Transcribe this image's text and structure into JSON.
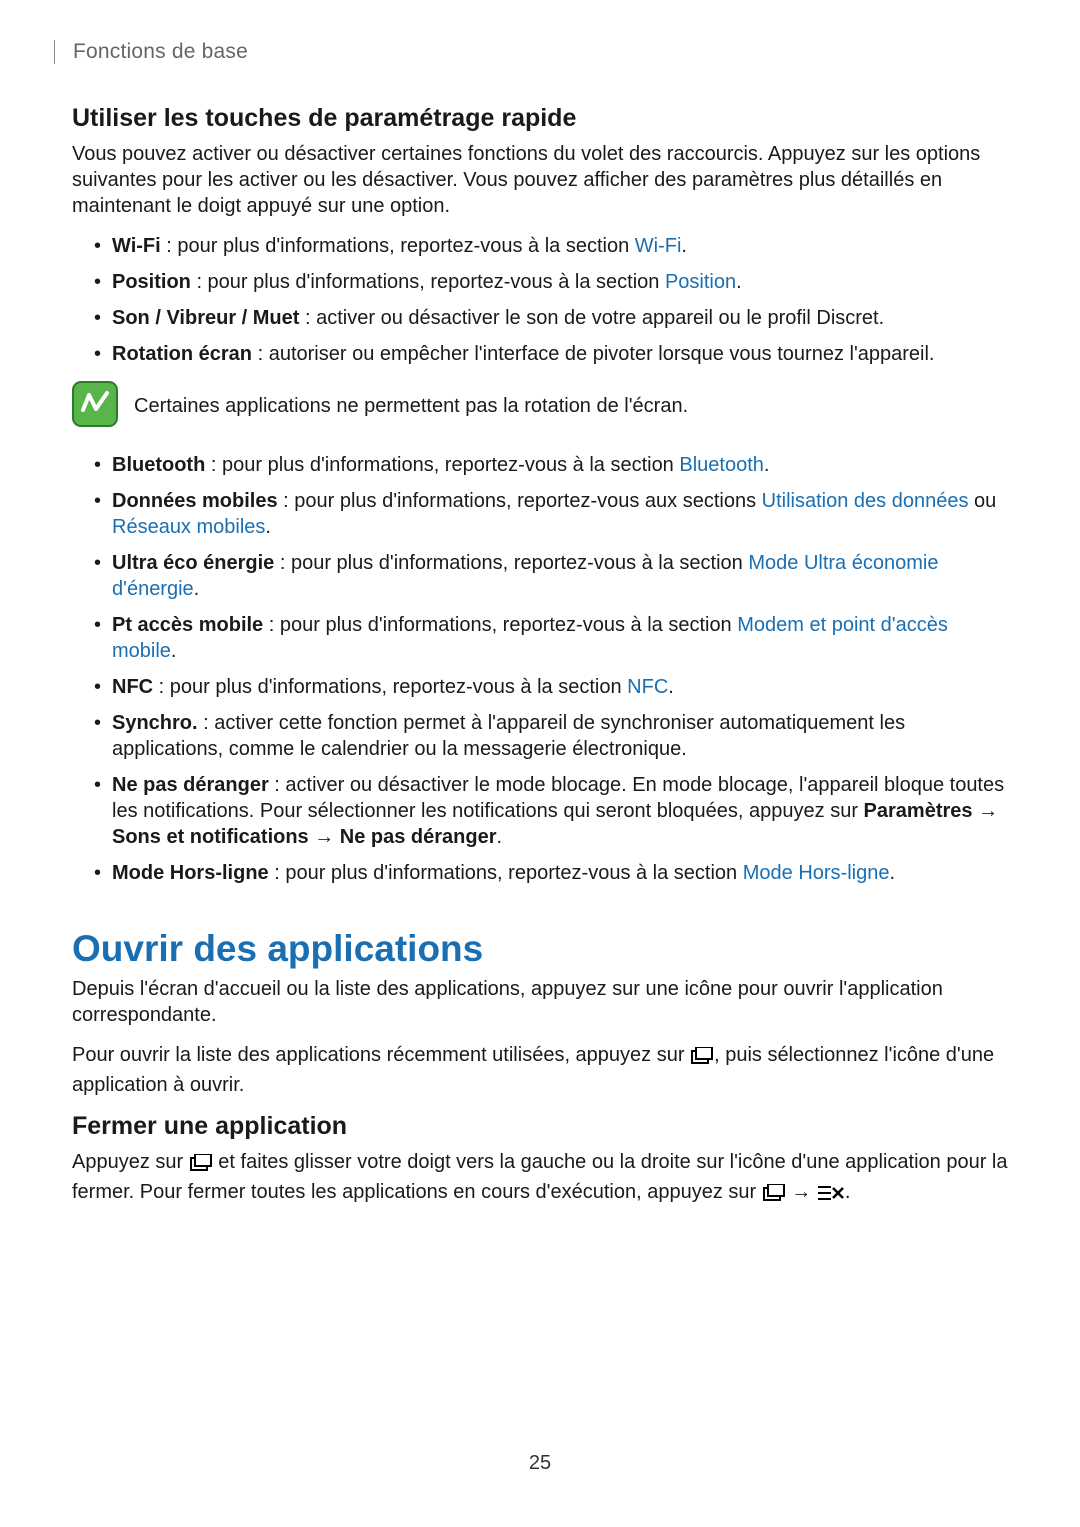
{
  "runningHead": "Fonctions de base",
  "h2a": "Utiliser les touches de paramétrage rapide",
  "p1": "Vous pouvez activer ou désactiver certaines fonctions du volet des raccourcis. Appuyez sur les options suivantes pour les activer ou les désactiver. Vous pouvez afficher des paramètres plus détaillés en maintenant le doigt appuyé sur une option.",
  "items1": {
    "wifi_label": "Wi-Fi",
    "wifi_text": " : pour plus d'informations, reportez-vous à la section ",
    "wifi_link": "Wi-Fi",
    "wifi_end": ".",
    "position_label": "Position",
    "position_text": " : pour plus d'informations, reportez-vous à la section ",
    "position_link": "Position",
    "position_end": ".",
    "son_label": "Son / Vibreur / Muet",
    "son_text": " : activer ou désactiver le son de votre appareil ou le profil Discret.",
    "rot_label": "Rotation écran",
    "rot_text": " : autoriser ou empêcher l'interface de pivoter lorsque vous tournez l'appareil."
  },
  "noteText": "Certaines applications ne permettent pas la rotation de l'écran.",
  "items2": {
    "bt_label": "Bluetooth",
    "bt_text": " : pour plus d'informations, reportez-vous à la section ",
    "bt_link": "Bluetooth",
    "bt_end": ".",
    "dm_label": "Données mobiles",
    "dm_text": " : pour plus d'informations, reportez-vous aux sections ",
    "dm_link1": "Utilisation des données",
    "dm_mid": " ou ",
    "dm_link2": "Réseaux mobiles",
    "dm_end": ".",
    "uee_label": "Ultra éco énergie",
    "uee_text": " : pour plus d'informations, reportez-vous à la section ",
    "uee_link": "Mode Ultra économie d'énergie",
    "uee_end": ".",
    "pam_label": "Pt accès mobile",
    "pam_text": " : pour plus d'informations, reportez-vous à la section ",
    "pam_link": "Modem et point d'accès mobile",
    "pam_end": ".",
    "nfc_label": "NFC",
    "nfc_text": " : pour plus d'informations, reportez-vous à la section ",
    "nfc_link": "NFC",
    "nfc_end": ".",
    "sync_label": "Synchro.",
    "sync_text": " : activer cette fonction permet à l'appareil de synchroniser automatiquement les applications, comme le calendrier ou la messagerie électronique.",
    "npd_label": "Ne pas déranger",
    "npd_text": " : activer ou désactiver le mode blocage. En mode blocage, l'appareil bloque toutes les notifications. Pour sélectionner les notifications qui seront bloquées, appuyez sur ",
    "npd_path": "Paramètres → Sons et notifications → Ne pas déranger",
    "npd_end": ".",
    "mhl_label": "Mode Hors-ligne",
    "mhl_text": " : pour plus d'informations, reportez-vous à la section ",
    "mhl_link": "Mode Hors-ligne",
    "mhl_end": "."
  },
  "h1": "Ouvrir des applications",
  "p2": "Depuis l'écran d'accueil ou la liste des applications, appuyez sur une icône pour ouvrir l'application correspondante.",
  "p3a": "Pour ouvrir la liste des applications récemment utilisées, appuyez sur ",
  "p3b": ", puis sélectionnez l'icône d'une application à ouvrir.",
  "h2b": "Fermer une application",
  "p4a": "Appuyez sur ",
  "p4b": " et faites glisser votre doigt vers la gauche ou la droite sur l'icône d'une application pour la fermer. Pour fermer toutes les applications en cours d'exécution, appuyez sur ",
  "p4arrow": " → ",
  "p4end": ".",
  "pageNum": "25"
}
